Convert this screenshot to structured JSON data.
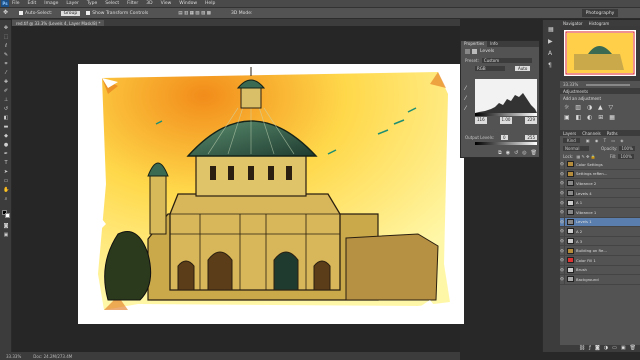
{
  "app": {
    "logo": "Ps"
  },
  "menu": [
    "File",
    "Edit",
    "Image",
    "Layer",
    "Type",
    "Select",
    "Filter",
    "3D",
    "View",
    "Window",
    "Help"
  ],
  "options": {
    "autoselect_label": "Auto-Select:",
    "autoselect_value": "Group",
    "transform_label": "Show Transform Controls",
    "mode_label": "3D Mode:"
  },
  "workspace": "Photography",
  "document": {
    "tab_label": "red.tif @ 33.3% (Levels 4, Layer Mask/8) *",
    "status_zoom": "33.33%",
    "status_doc": "Doc: 24.2M/273.4M"
  },
  "properties": {
    "tabs": [
      "Properties",
      "Info"
    ],
    "title": "Levels",
    "preset_label": "Preset:",
    "preset_value": "Custom",
    "channel_value": "RGB",
    "auto_label": "Auto",
    "input_values": [
      "116",
      "1.00",
      "229"
    ],
    "output_label": "Output Levels:",
    "output_values": [
      "0",
      "255"
    ]
  },
  "navigator": {
    "tabs": [
      "Navigator",
      "Histogram"
    ],
    "zoom": "33.33%"
  },
  "adjustments": {
    "tab": "Adjustments",
    "title": "Add an adjustment"
  },
  "layers": {
    "tabs": [
      "Layers",
      "Channels",
      "Paths"
    ],
    "kind_label": "Kind",
    "blend_mode": "Normal",
    "opacity_label": "Opacity:",
    "opacity": "100%",
    "lock_label": "Lock:",
    "fill_label": "Fill:",
    "fill": "100%",
    "rows": [
      {
        "name": "Color Settings",
        "kind": "group"
      },
      {
        "name": "Settings reRen...",
        "kind": "group"
      },
      {
        "name": "Vibrance 2",
        "kind": "adj"
      },
      {
        "name": "Levels 4",
        "kind": "adj"
      },
      {
        "name": "A 1",
        "kind": "layer"
      },
      {
        "name": "Vibrance 1",
        "kind": "adj"
      },
      {
        "name": "Levels 1",
        "kind": "adj",
        "selected": true
      },
      {
        "name": "A 2",
        "kind": "layer"
      },
      {
        "name": "A 3",
        "kind": "layer"
      },
      {
        "name": "Building on Re...",
        "kind": "group"
      },
      {
        "name": "Color Fill 1",
        "kind": "fill"
      },
      {
        "name": "Brush",
        "kind": "layer"
      },
      {
        "name": "Background",
        "kind": "bg"
      }
    ]
  },
  "tools": [
    "move",
    "marquee",
    "lasso",
    "quick-select",
    "crop",
    "eyedropper",
    "heal",
    "brush",
    "stamp",
    "history-brush",
    "eraser",
    "gradient",
    "blur",
    "dodge",
    "pen",
    "type",
    "path-select",
    "shape",
    "hand",
    "zoom"
  ],
  "colors": {
    "accent": "#5a7fae",
    "panel": "#535353",
    "dark": "#3c3c3c",
    "sky_orange": "#f5a623",
    "sky_yellow": "#fff27a"
  }
}
